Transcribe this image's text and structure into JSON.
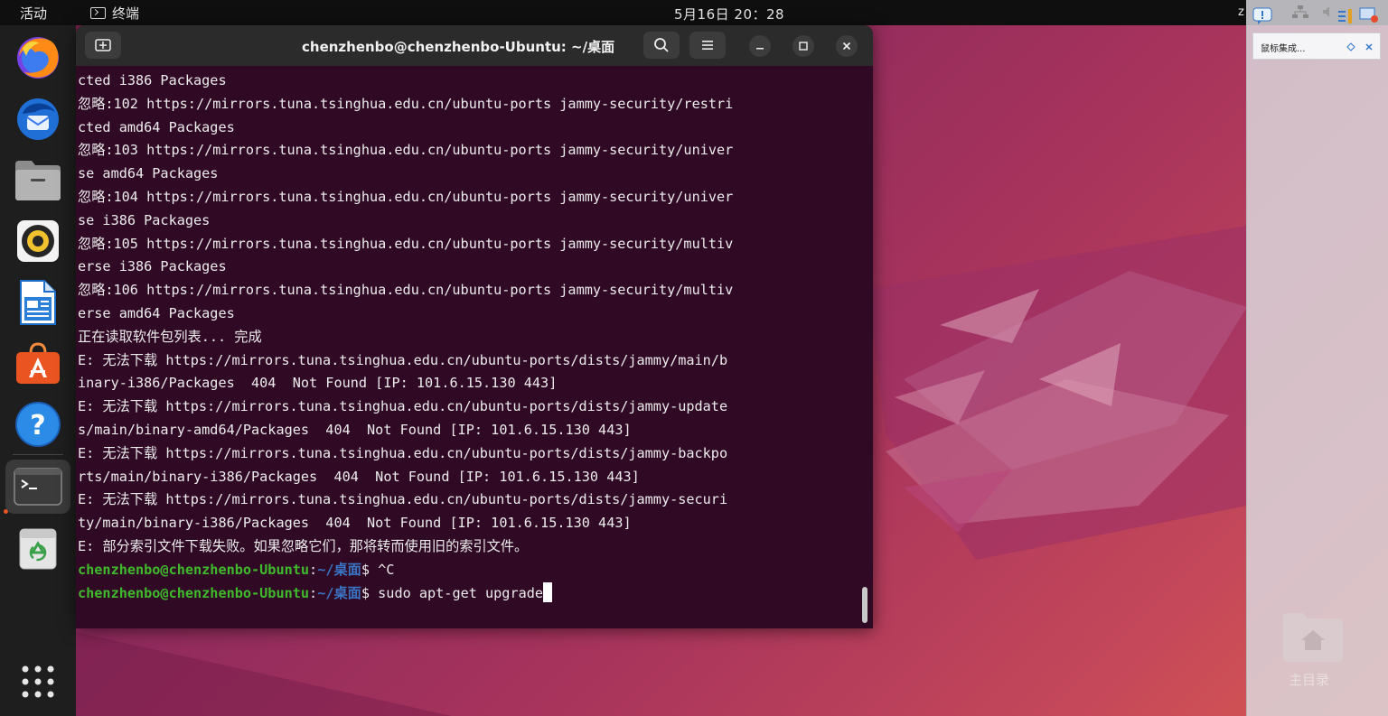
{
  "topbar": {
    "activities": "活动",
    "app_name": "终端",
    "clock": "5月16日  20：28",
    "right_fragment": "z"
  },
  "dock": {
    "apps": [
      {
        "name": "firefox",
        "icon": "firefox-icon"
      },
      {
        "name": "thunderbird",
        "icon": "thunderbird-icon"
      },
      {
        "name": "files",
        "icon": "files-icon"
      },
      {
        "name": "rhythmbox",
        "icon": "rhythmbox-icon"
      },
      {
        "name": "libreoffice-writer",
        "icon": "writer-icon"
      },
      {
        "name": "ubuntu-software",
        "icon": "software-icon"
      },
      {
        "name": "help",
        "icon": "help-icon"
      },
      {
        "name": "terminal",
        "icon": "terminal-icon",
        "running": true
      },
      {
        "name": "trash",
        "icon": "trash-icon"
      },
      {
        "name": "show-apps",
        "icon": "app-grid-icon"
      }
    ]
  },
  "terminal": {
    "title": "chenzhenbo@chenzhenbo-Ubuntu: ~/桌面",
    "lines": [
      "cted i386 Packages",
      "忽略:102 https://mirrors.tuna.tsinghua.edu.cn/ubuntu-ports jammy-security/restri",
      "cted amd64 Packages",
      "忽略:103 https://mirrors.tuna.tsinghua.edu.cn/ubuntu-ports jammy-security/univer",
      "se amd64 Packages",
      "忽略:104 https://mirrors.tuna.tsinghua.edu.cn/ubuntu-ports jammy-security/univer",
      "se i386 Packages",
      "忽略:105 https://mirrors.tuna.tsinghua.edu.cn/ubuntu-ports jammy-security/multiv",
      "erse i386 Packages",
      "忽略:106 https://mirrors.tuna.tsinghua.edu.cn/ubuntu-ports jammy-security/multiv",
      "erse amd64 Packages",
      "正在读取软件包列表... 完成",
      "E: 无法下载 https://mirrors.tuna.tsinghua.edu.cn/ubuntu-ports/dists/jammy/main/b",
      "inary-i386/Packages  404  Not Found [IP: 101.6.15.130 443]",
      "E: 无法下载 https://mirrors.tuna.tsinghua.edu.cn/ubuntu-ports/dists/jammy-update",
      "s/main/binary-amd64/Packages  404  Not Found [IP: 101.6.15.130 443]",
      "E: 无法下载 https://mirrors.tuna.tsinghua.edu.cn/ubuntu-ports/dists/jammy-backpo",
      "rts/main/binary-i386/Packages  404  Not Found [IP: 101.6.15.130 443]",
      "E: 无法下载 https://mirrors.tuna.tsinghua.edu.cn/ubuntu-ports/dists/jammy-securi",
      "ty/main/binary-i386/Packages  404  Not Found [IP: 101.6.15.130 443]",
      "E: 部分索引文件下载失败。如果忽略它们，那将转而使用旧的索引文件。"
    ],
    "prompt_user": "chenzhenbo@chenzhenbo-Ubuntu",
    "prompt_sep": ":",
    "prompt_path": "~/桌面",
    "prompt_symbol": "$ ",
    "prev_command": "^C",
    "current_command": "sudo apt-get upgrade"
  },
  "sidepanel": {
    "notification_text": "鼠标集成..."
  },
  "desktop": {
    "home_label": "主目录"
  },
  "colors": {
    "terminal_bg": "#300a24",
    "prompt_user": "#3fba2c",
    "prompt_path": "#3a74c4",
    "accent": "#e95420"
  }
}
